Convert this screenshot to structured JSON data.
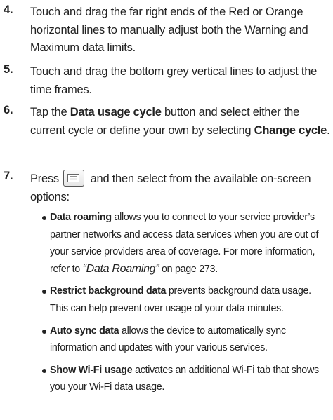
{
  "steps": [
    {
      "num": "4.",
      "text": "Touch and drag the far right ends of the Red or Orange horizontal lines to manually adjust both the Warning and Maximum data limits."
    },
    {
      "num": "5.",
      "text": "Touch and drag the bottom grey vertical lines to adjust the time frames."
    },
    {
      "num": "6.",
      "pre": "Tap the ",
      "bold1": "Data usage cycle",
      "mid": " button and select either the current cycle or define your own by selecting ",
      "bold2": "Change cycle",
      "post": "."
    },
    {
      "num": "7.",
      "pre": "Press ",
      "icon": "menu-key-icon",
      "post": " and then select from the available on-screen options:"
    }
  ],
  "options": [
    {
      "name": "Data roaming",
      "text": " allows you to connect to your service provider’s partner networks and access data services when you are out of your service providers area of coverage. For more information, refer to ",
      "xref": "“Data Roaming”",
      "tail": " on page 273."
    },
    {
      "name": "Restrict background data",
      "text": " prevents background data usage. This can help prevent over usage of your data minutes."
    },
    {
      "name": "Auto sync data",
      "text": " allows the device to automatically sync information and updates with your various services."
    },
    {
      "name": "Show Wi-Fi usage",
      "text": " activates an additional Wi-Fi tab that shows you your Wi-Fi data usage."
    }
  ]
}
